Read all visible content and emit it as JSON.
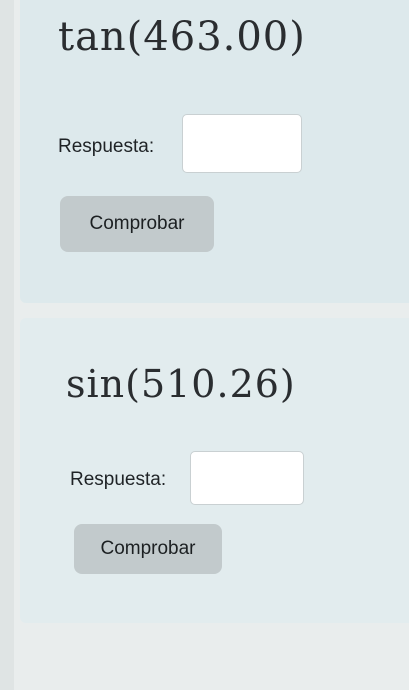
{
  "problems": [
    {
      "expression": "tan(463.00)",
      "answer_label": "Respuesta:",
      "answer_value": "",
      "button_label": "Comprobar"
    },
    {
      "expression": "sin(510.26)",
      "answer_label": "Respuesta:",
      "answer_value": "",
      "button_label": "Comprobar"
    }
  ],
  "colors": {
    "page_background": "#e9eded",
    "card_background": "#dde9ec",
    "button_background": "#c2cacc",
    "input_background": "#ffffff"
  }
}
